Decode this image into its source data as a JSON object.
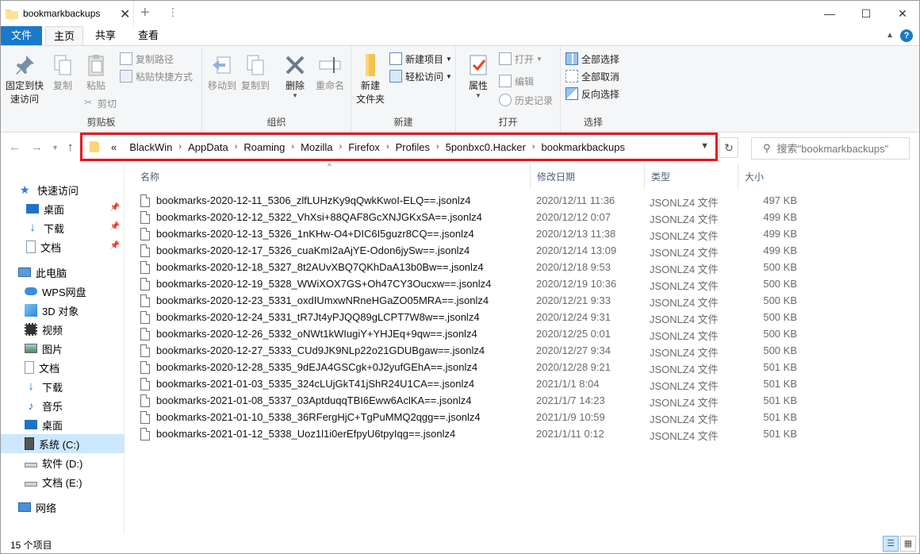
{
  "window": {
    "tab_title": "bookmarkbackups",
    "minimize": "—",
    "maximize": "☐",
    "close": "✕"
  },
  "ribbon_tabs": {
    "file": "文件",
    "home": "主页",
    "share": "共享",
    "view": "查看"
  },
  "ribbon": {
    "clipboard": {
      "label": "剪贴板",
      "pin": "固定到快\n速访问",
      "copy": "复制",
      "paste": "粘贴",
      "copy_path": "复制路径",
      "paste_shortcut": "粘贴快捷方式",
      "cut": "剪切"
    },
    "organize": {
      "label": "组织",
      "move_to": "移动到",
      "copy_to": "复制到",
      "delete": "删除",
      "rename": "重命名"
    },
    "new": {
      "label": "新建",
      "new_folder": "新建\n文件夹",
      "new_item": "新建项目",
      "easy_access": "轻松访问"
    },
    "open": {
      "label": "打开",
      "properties": "属性",
      "open": "打开",
      "edit": "编辑",
      "history": "历史记录"
    },
    "select": {
      "label": "选择",
      "select_all": "全部选择",
      "select_none": "全部取消",
      "invert": "反向选择"
    }
  },
  "address": {
    "overflow": "«",
    "crumbs": [
      "BlackWin",
      "AppData",
      "Roaming",
      "Mozilla",
      "Firefox",
      "Profiles",
      "5ponbxc0.Hacker",
      "bookmarkbackups"
    ]
  },
  "search": {
    "placeholder": "搜索\"bookmarkbackups\""
  },
  "nav": {
    "quick_access": "快速访问",
    "desktop1": "桌面",
    "downloads1": "下载",
    "documents1": "文档",
    "this_pc": "此电脑",
    "wps": "WPS网盘",
    "objects3d": "3D 对象",
    "videos": "视频",
    "pictures": "图片",
    "documents2": "文档",
    "downloads2": "下载",
    "music": "音乐",
    "desktop2": "桌面",
    "drive_c": "系统 (C:)",
    "drive_d": "软件 (D:)",
    "drive_e": "文档 (E:)",
    "network": "网络"
  },
  "columns": {
    "name": "名称",
    "date": "修改日期",
    "type": "类型",
    "size": "大小"
  },
  "files": [
    {
      "name": "bookmarks-2020-12-11_5306_zlfLUHzKy9qQwkKwoI-ELQ==.jsonlz4",
      "date": "2020/12/11 11:36",
      "type": "JSONLZ4 文件",
      "size": "497 KB"
    },
    {
      "name": "bookmarks-2020-12-12_5322_VhXsi+88QAF8GcXNJGKxSA==.jsonlz4",
      "date": "2020/12/12 0:07",
      "type": "JSONLZ4 文件",
      "size": "499 KB"
    },
    {
      "name": "bookmarks-2020-12-13_5326_1nKHw-O4+DIC6I5guzr8CQ==.jsonlz4",
      "date": "2020/12/13 11:38",
      "type": "JSONLZ4 文件",
      "size": "499 KB"
    },
    {
      "name": "bookmarks-2020-12-17_5326_cuaKmI2aAjYE-Odon6jySw==.jsonlz4",
      "date": "2020/12/14 13:09",
      "type": "JSONLZ4 文件",
      "size": "499 KB"
    },
    {
      "name": "bookmarks-2020-12-18_5327_8t2AUvXBQ7QKhDaA13b0Bw==.jsonlz4",
      "date": "2020/12/18 9:53",
      "type": "JSONLZ4 文件",
      "size": "500 KB"
    },
    {
      "name": "bookmarks-2020-12-19_5328_WWiXOX7GS+Oh47CY3Oucxw==.jsonlz4",
      "date": "2020/12/19 10:36",
      "type": "JSONLZ4 文件",
      "size": "500 KB"
    },
    {
      "name": "bookmarks-2020-12-23_5331_oxdIUmxwNRneHGaZO05MRA==.jsonlz4",
      "date": "2020/12/21 9:33",
      "type": "JSONLZ4 文件",
      "size": "500 KB"
    },
    {
      "name": "bookmarks-2020-12-24_5331_tR7Jt4yPJQQ89gLCPT7W8w==.jsonlz4",
      "date": "2020/12/24 9:31",
      "type": "JSONLZ4 文件",
      "size": "500 KB"
    },
    {
      "name": "bookmarks-2020-12-26_5332_oNWt1kWIugiY+YHJEq+9qw==.jsonlz4",
      "date": "2020/12/25 0:01",
      "type": "JSONLZ4 文件",
      "size": "500 KB"
    },
    {
      "name": "bookmarks-2020-12-27_5333_CUd9JK9NLp22o21GDUBgaw==.jsonlz4",
      "date": "2020/12/27 9:34",
      "type": "JSONLZ4 文件",
      "size": "500 KB"
    },
    {
      "name": "bookmarks-2020-12-28_5335_9dEJA4GSCgk+0J2yufGEhA==.jsonlz4",
      "date": "2020/12/28 9:21",
      "type": "JSONLZ4 文件",
      "size": "501 KB"
    },
    {
      "name": "bookmarks-2021-01-03_5335_324cLUjGkT41jShR24U1CA==.jsonlz4",
      "date": "2021/1/1 8:04",
      "type": "JSONLZ4 文件",
      "size": "501 KB"
    },
    {
      "name": "bookmarks-2021-01-08_5337_03AptduqqTBI6Eww6AclKA==.jsonlz4",
      "date": "2021/1/7 14:23",
      "type": "JSONLZ4 文件",
      "size": "501 KB"
    },
    {
      "name": "bookmarks-2021-01-10_5338_36RFergHjC+TgPuMMQ2qgg==.jsonlz4",
      "date": "2021/1/9 10:59",
      "type": "JSONLZ4 文件",
      "size": "501 KB"
    },
    {
      "name": "bookmarks-2021-01-12_5338_Uoz1l1i0erEfpyU6tpyIqg==.jsonlz4",
      "date": "2021/1/11 0:12",
      "type": "JSONLZ4 文件",
      "size": "501 KB"
    }
  ],
  "status": {
    "count": "15 个项目"
  },
  "colors": {
    "accent": "#1979ca",
    "highlight_box": "#e8141c",
    "selection": "#cce8ff"
  }
}
